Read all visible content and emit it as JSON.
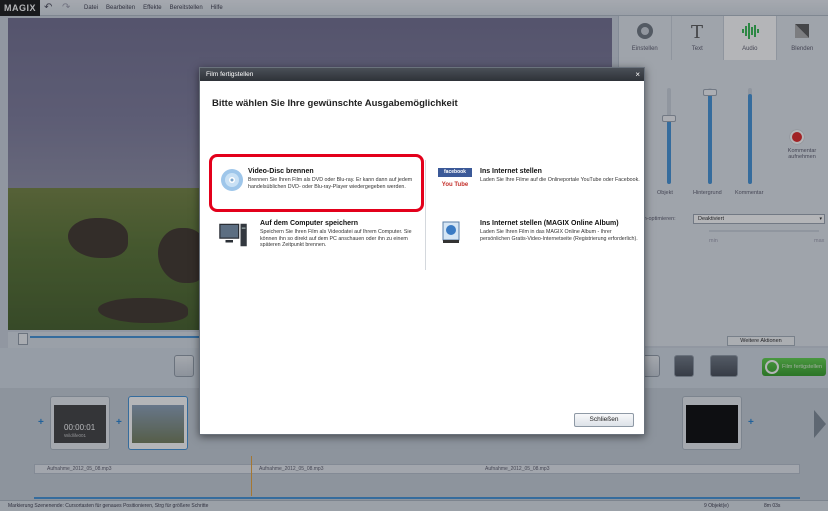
{
  "app": {
    "logo": "MAGIX"
  },
  "menu": {
    "items": [
      "Datei",
      "Bearbeiten",
      "Effekte",
      "Bereitstellen",
      "Hilfe"
    ]
  },
  "right_panel": {
    "tabs": [
      {
        "label": "Einstellen",
        "icon": "dial-icon"
      },
      {
        "label": "Text",
        "icon": "text-t-icon"
      },
      {
        "label": "Audio",
        "icon": "audio-wave-icon",
        "active": true
      },
      {
        "label": "Blenden",
        "icon": "transition-icon"
      }
    ],
    "sliders": [
      "Objekt",
      "Hintergrund",
      "Kommentar"
    ],
    "comment_record": "Kommentar aufnehmen",
    "optimize_label": "ton-optimieren:",
    "optimize_value": "Deaktiviert",
    "range_min": "min",
    "range_max": "max",
    "more_actions": "Weitere Aktionen"
  },
  "toolbar": {
    "finish_label": "Film fertigstellen"
  },
  "timeline": {
    "first_clip_time": "00:00:01",
    "first_clip_name": "Wildlife001",
    "audio_clips": [
      "Aufnahme_2012_05_08.mp3",
      "Aufnahme_2012_05_08.mp3",
      "Aufnahme_2012_05_08.mp3"
    ],
    "status": "Markierung Szenenende: Cursortasten für genaues Positionieren, Strg für größere Schritte",
    "objects": "9 Objekt(e)",
    "length": "8m 03s"
  },
  "dialog": {
    "title": "Film fertigstellen",
    "close": "×",
    "heading": "Bitte wählen Sie Ihre gewünschte Ausgabemöglichkeit",
    "options": [
      {
        "title": "Video-Disc brennen",
        "desc": "Brennen Sie Ihren Film als DVD oder Blu-ray. Er kann dann auf jedem handelsüblichen DVD- oder Blu-ray-Player wiedergegeben werden.",
        "icon": "disc-icon"
      },
      {
        "title": "Ins Internet stellen",
        "desc": "Laden Sie Ihre Filme auf die Onlineportale YouTube oder Facebook.",
        "icon": "facebook-youtube-icon"
      },
      {
        "title": "Auf dem Computer speichern",
        "desc": "Speichern Sie Ihren Film als Videodatei auf Ihrem Computer. Sie können ihn so direkt auf dem PC anschauen oder ihn zu einem späteren Zeitpunkt brennen.",
        "icon": "computer-icon"
      },
      {
        "title": "Ins Internet stellen (MAGIX Online Album)",
        "desc": "Laden Sie Ihren Film in das MAGIX Online Album - Ihrer persönlichen Gratis-Video-Internetseite (Registrierung erforderlich).",
        "icon": "online-album-icon"
      }
    ],
    "close_button": "Schließen",
    "facebook_label": "facebook",
    "youtube_label": "You Tube"
  }
}
